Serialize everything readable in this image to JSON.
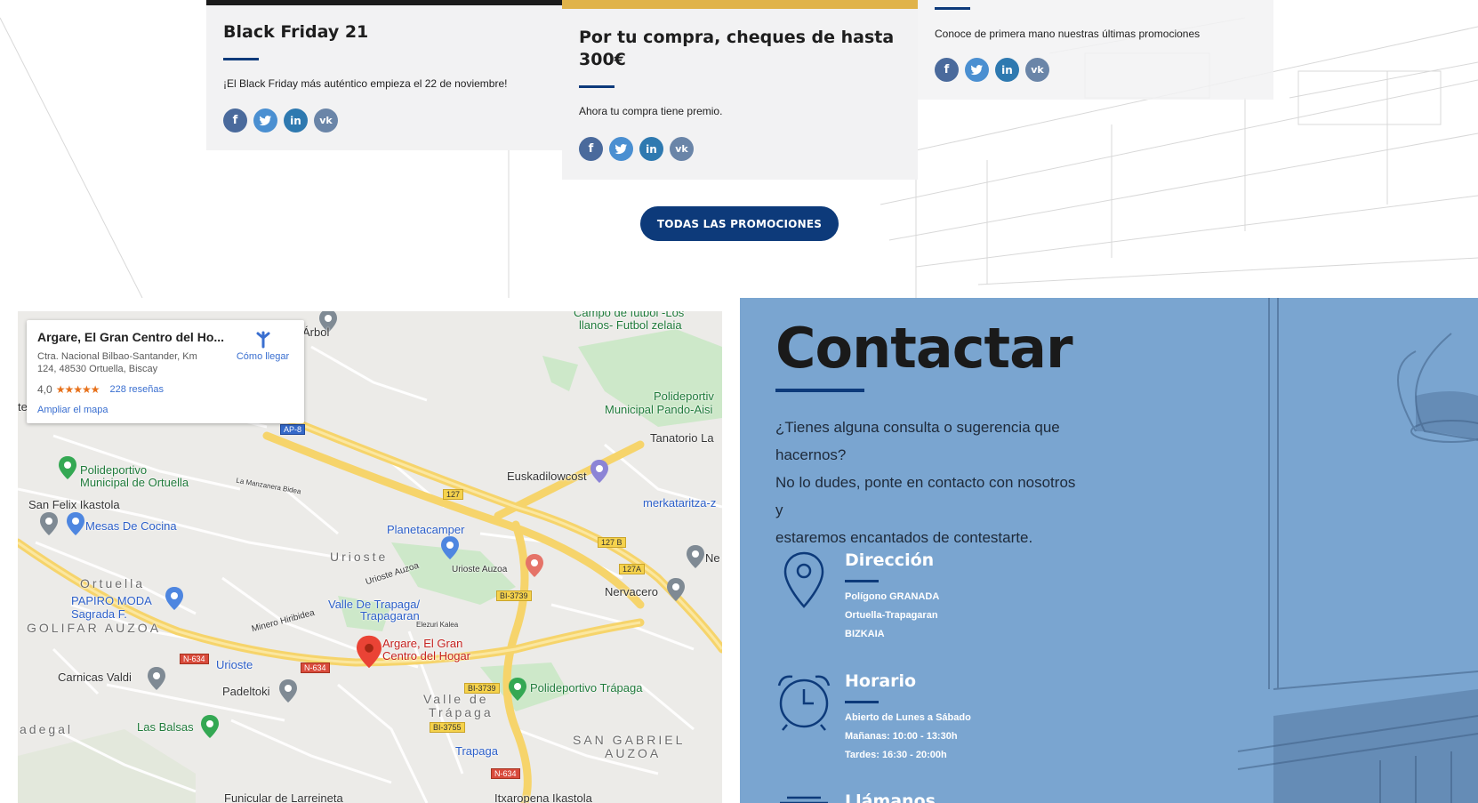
{
  "promos": [
    {
      "title": "Black Friday 21",
      "text": "¡El Black Friday más auténtico empieza el 22 de noviembre!"
    },
    {
      "title_line1": "Por tu compra, cheques de hasta",
      "title_line2": "300€",
      "text": "Ahora tu compra tiene premio."
    },
    {
      "text": "Conoce de primera mano nuestras últimas promociones"
    }
  ],
  "social_icons": [
    "facebook-icon",
    "twitter-icon",
    "linkedin-icon",
    "vk-icon"
  ],
  "colors": {
    "brand": "#0d3a7a",
    "contact_bg": "#7aa5d0",
    "social": "#4a6a9c",
    "card_bg": "#f2f2f3"
  },
  "promos_button": "TODAS LAS PROMOCIONES",
  "map": {
    "card": {
      "title": "Argare, El Gran Centro del Ho...",
      "address": "Ctra. Nacional Bilbao-Santander, Km 124, 48530 Ortuella, Biscay",
      "rating": "4,0",
      "stars": "★★★★★",
      "reviews": "228 reseñas",
      "enlarge": "Ampliar el mapa",
      "directions": "Cómo llegar"
    },
    "labels": {
      "arbol": "Árbol",
      "campo1": "Campo de fútbol -Los",
      "campo2": "llanos- Futbol zelaia",
      "polinp1": "Polideportiv",
      "polinp2": "Municipal Pando-Aisi",
      "tanatorio": "Tanatorio La",
      "polort1": "Polideportivo",
      "polort2": "Municipal de Ortuella",
      "euskadi": "Euskadilowcost",
      "merka": "merkataritza-z",
      "sanfelix": "San Felix Ikastola",
      "mesas": "Mesas De Cocina",
      "planeta": "Planetacamper",
      "urioste_area": "Urioste",
      "urioste_auzoa1": "Urioste Auzoa",
      "urioste_auzoa2": "Urioste Auzoa",
      "ne": "Ne",
      "ortuella": "Ortuella",
      "nervacero": "Nervacero",
      "papiro": "PAPIRO MODA",
      "sagrada": "Sagrada F.",
      "valle1": "Valle De Trapaga/",
      "valle2": "Trapagaran",
      "golifar": "GOLIFAR AUZOA",
      "minero": "Minero Hiribidea",
      "argare1": "Argare, El Gran",
      "argare2": "Centro del Hogar",
      "carnicas": "Carnicas Valdi",
      "urioste_stop": "Urioste",
      "padeltoki": "Padeltoki",
      "poltrapaga": "Polideportivo Trápaga",
      "valle_area1": "Valle de",
      "valle_area2": "Trápaga",
      "adegal": "adegal",
      "balsas": "Las Balsas",
      "trapaga": "Trapaga",
      "sangabriel1": "SAN GABRIEL",
      "sangabriel2": "AUZOA",
      "funicular": "Funicular de Larreineta",
      "itxaropena": "Itxaropena Ikastola",
      "la_manzanera": "La Manzanera Bidea",
      "elezuri": "Elezuri Kalea",
      "te": "te"
    },
    "shields": {
      "ap8": "AP-8",
      "s127": "127",
      "s127b": "127 B",
      "s127a": "127A",
      "bi3739a": "BI-3739",
      "n634a": "N-634",
      "n634b": "N-634",
      "bi3739b": "BI-3739",
      "bi3755": "BI-3755",
      "n634c": "N-634"
    }
  },
  "contact": {
    "title": "Contactar",
    "intro_line1": "¿Tienes alguna consulta o sugerencia que",
    "intro_line2": "hacernos?",
    "intro_line3": "No lo dudes, ponte en contacto con nosotros y",
    "intro_line4": "estaremos encantados de contestarte.",
    "address": {
      "title": "Dirección",
      "line1": "Polígono GRANADA",
      "line2": "Ortuella-Trapagaran",
      "line3": "BIZKAIA"
    },
    "hours": {
      "title": "Horario",
      "line1": "Abierto de Lunes a Sábado",
      "line2": "Mañanas: 10:00 - 13:30h",
      "line3": "Tardes: 16:30 - 20:00h"
    },
    "phone": {
      "title": "Llámanos"
    }
  }
}
